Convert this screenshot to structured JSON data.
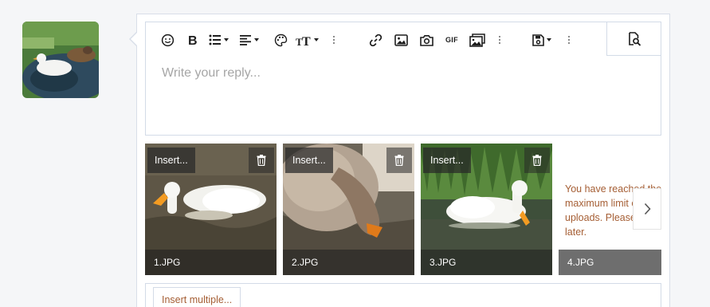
{
  "editor": {
    "placeholder": "Write your reply...",
    "toolbar": [
      {
        "icon": "smiley-icon",
        "label": "Smilies"
      },
      {
        "icon": "bold-icon",
        "label": "Bold"
      },
      {
        "icon": "list-icon",
        "label": "List"
      },
      {
        "icon": "align-icon",
        "label": "Alignment"
      },
      {
        "icon": "palette-icon",
        "label": "Text color"
      },
      {
        "icon": "font-size-icon",
        "label": "Font size"
      },
      {
        "icon": "link-icon",
        "label": "Link"
      },
      {
        "icon": "image-icon",
        "label": "Image"
      },
      {
        "icon": "camera-icon",
        "label": "Media"
      },
      {
        "icon": "gif-icon",
        "label": "GIF"
      },
      {
        "icon": "gallery-icon",
        "label": "Gallery"
      },
      {
        "icon": "save-icon",
        "label": "Drafts"
      },
      {
        "icon": "preview-icon",
        "label": "Preview"
      }
    ],
    "gif_text": "GIF"
  },
  "attachments": [
    {
      "name": "1.JPG",
      "insert_label": "Insert..."
    },
    {
      "name": "2.JPG",
      "insert_label": "Insert..."
    },
    {
      "name": "3.JPG",
      "insert_label": "Insert..."
    },
    {
      "name": "4.JPG",
      "error": "You have reached the maximum limit of attachment uploads. Please try again later."
    }
  ],
  "insert_multiple_label": "Insert multiple...",
  "colors": {
    "accent": "#a55e34",
    "border": "#d3dbe7",
    "placeholder": "#a6a6a6"
  }
}
